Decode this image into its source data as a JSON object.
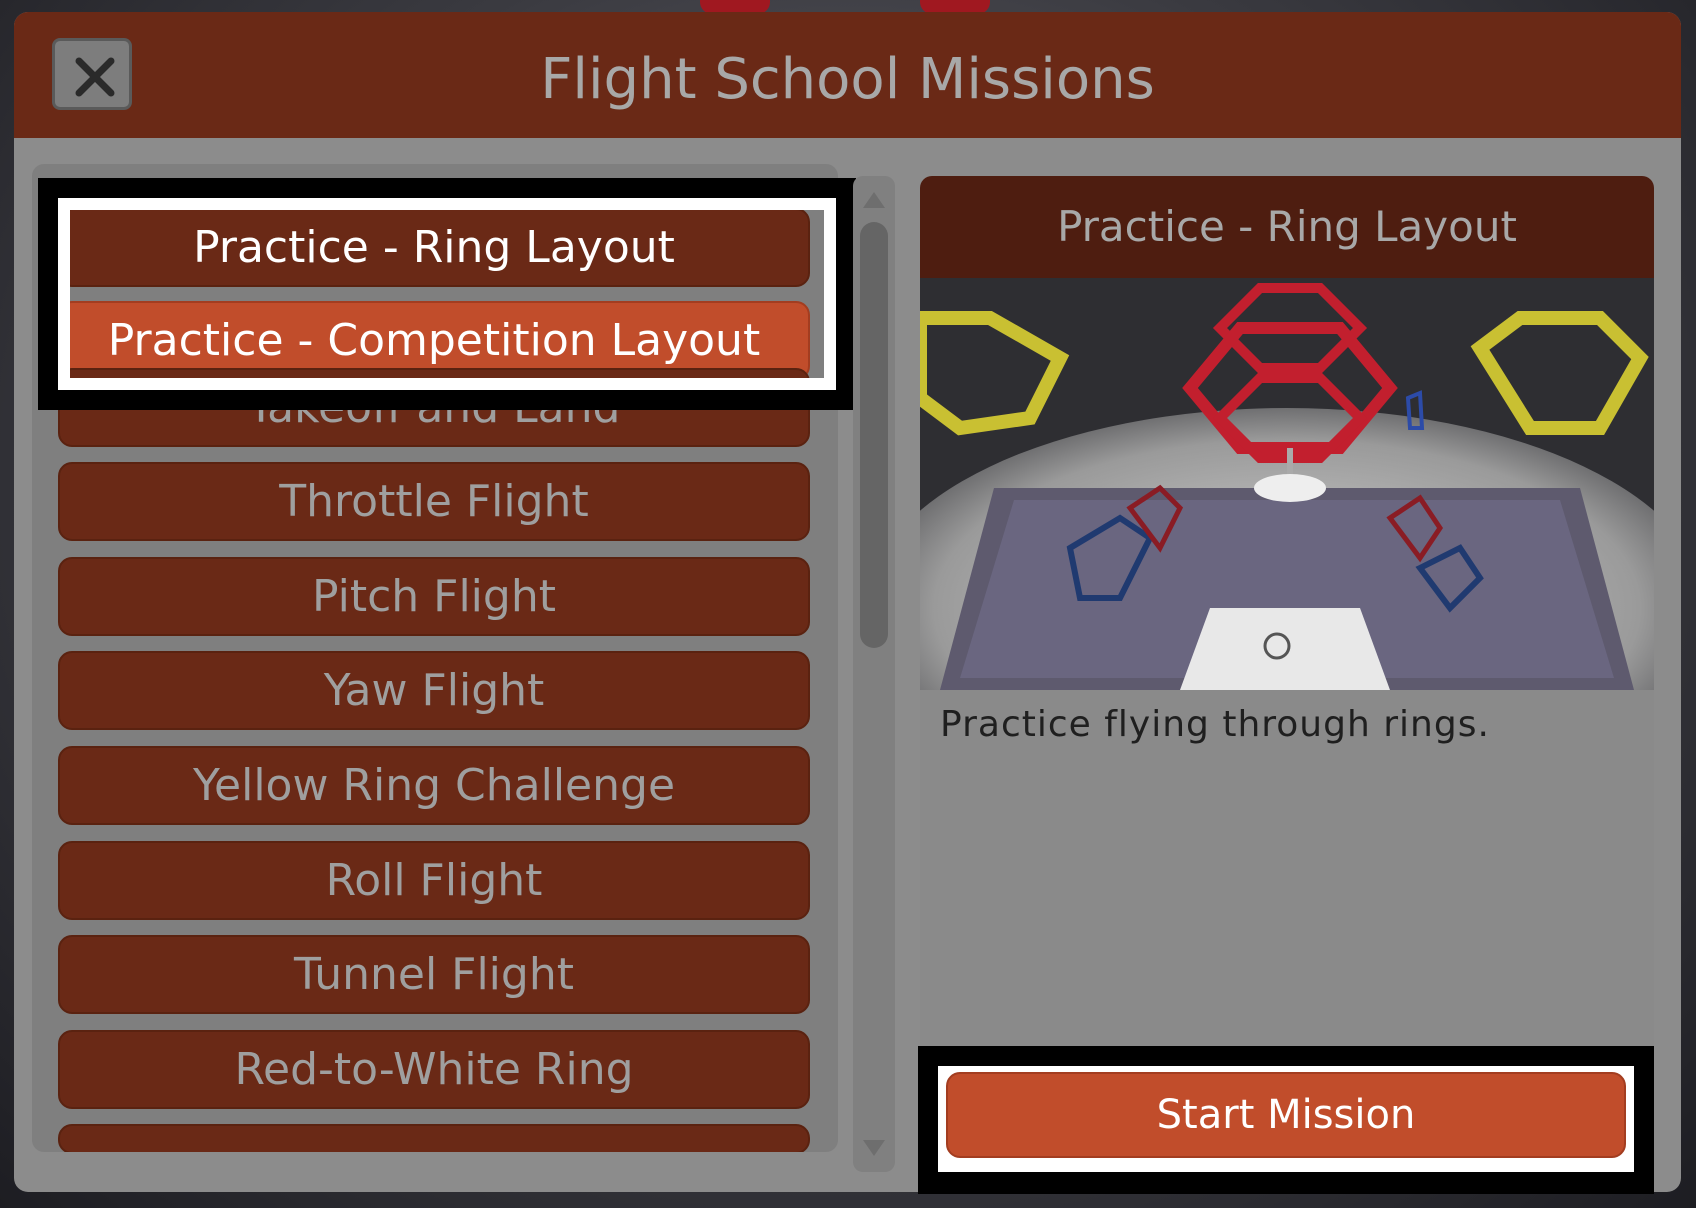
{
  "dialog": {
    "title": "Flight School Missions"
  },
  "missions": [
    {
      "label": "Practice - Ring Layout",
      "state": "selected"
    },
    {
      "label": "Practice - Competition Layout",
      "state": "hovered"
    },
    {
      "label": "Takeoff and Land",
      "state": "normal"
    },
    {
      "label": "Throttle Flight",
      "state": "normal"
    },
    {
      "label": "Pitch Flight",
      "state": "normal"
    },
    {
      "label": "Yaw Flight",
      "state": "normal"
    },
    {
      "label": "Yellow Ring Challenge",
      "state": "normal"
    },
    {
      "label": "Roll Flight",
      "state": "normal"
    },
    {
      "label": "Tunnel Flight",
      "state": "normal"
    },
    {
      "label": "Red-to-White Ring",
      "state": "normal"
    }
  ],
  "detail": {
    "title": "Practice - Ring Layout",
    "description": "Practice flying through rings.",
    "start_label": "Start Mission"
  },
  "colors": {
    "header": "#6a2916",
    "button": "#6a2916",
    "accent": "#c14d2b",
    "panel": "#8c8c8c"
  }
}
